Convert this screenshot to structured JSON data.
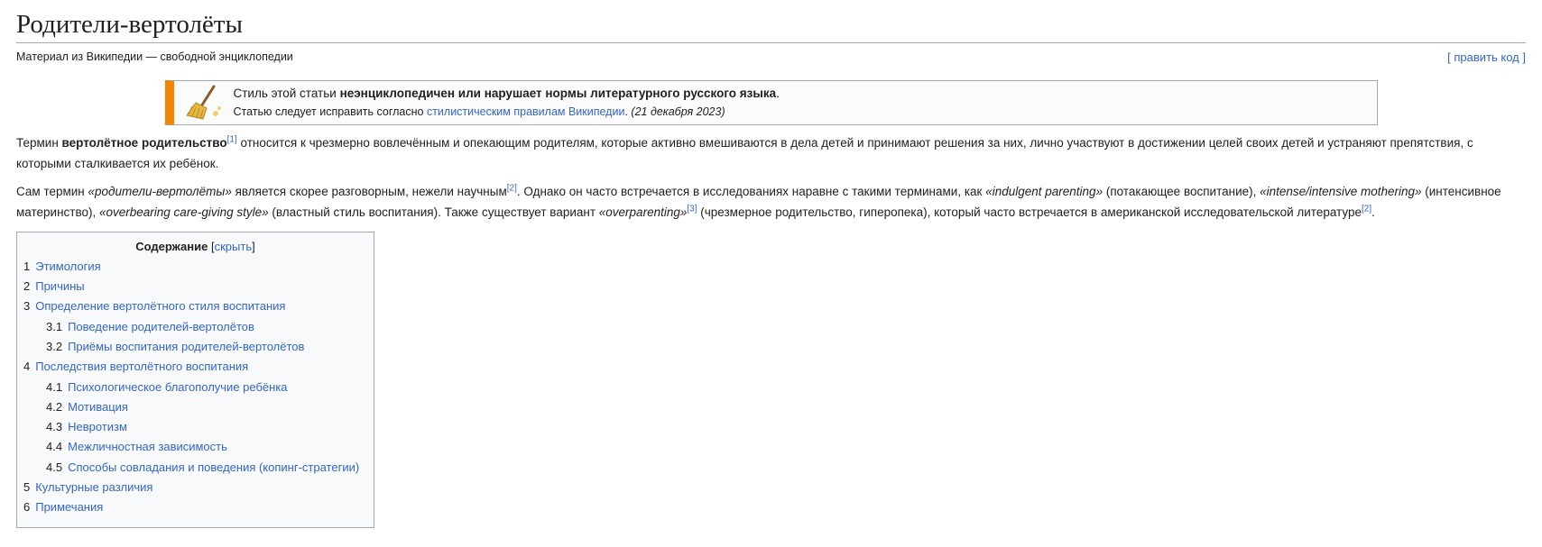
{
  "page": {
    "title": "Родители-вертолёты",
    "source": "Материал из Википедии — свободной энциклопедии",
    "edit_link": "[ править код ]"
  },
  "ambox": {
    "icon": "broom-icon",
    "accent_color": "#f28500",
    "line1_prefix": "Стиль этой статьи ",
    "line1_bold": "неэнциклопедичен или нарушает нормы литературного русского языка",
    "line1_suffix": ".",
    "line2_prefix": "Статью следует исправить согласно ",
    "line2_link": "стилистическим правилам Википедии",
    "line2_sep": ". ",
    "line2_date": "(21 декабря 2023)"
  },
  "para1": {
    "t1": "Термин ",
    "b1": "вертолётное родительство",
    "ref1": "[1]",
    "t2": " относится к чрезмерно вовлечённым и опекающим родителям, которые активно вмешиваются в дела детей и принимают решения за них, лично участвуют в достижении целей своих детей и устраняют препятствия, с которыми сталкивается их ребёнок."
  },
  "para2": {
    "t1": "Сам термин ",
    "i1": "«родители-вертолёты»",
    "t2": " является скорее разговорным, нежели научным",
    "ref1": "[2]",
    "t3": ". Однако он часто встречается в исследованиях наравне с такими терминами, как ",
    "i2": "«indulgent parenting»",
    "t4": " (потакающее воспитание), ",
    "i3": "«intense/intensive mothering»",
    "t5": " (интенсивное материнство), ",
    "i4": "«overbearing care-giving style»",
    "t6": " (властный стиль воспитания). Также существует вариант ",
    "i5": "«overparenting»",
    "ref2": "[3]",
    "t7": " (чрезмерное родительство, гиперопека), который часто встречается в американской исследовательской литературе",
    "ref3": "[2]",
    "t8": "."
  },
  "toc": {
    "title": "Содержание",
    "toggle_open": "[",
    "toggle": "скрыть",
    "toggle_close": "]",
    "items": [
      {
        "num": "1",
        "label": "Этимология",
        "level": 1
      },
      {
        "num": "2",
        "label": "Причины",
        "level": 1
      },
      {
        "num": "3",
        "label": "Определение вертолётного стиля воспитания",
        "level": 1
      },
      {
        "num": "3.1",
        "label": "Поведение родителей-вертолётов",
        "level": 2
      },
      {
        "num": "3.2",
        "label": "Приёмы воспитания родителей-вертолётов",
        "level": 2
      },
      {
        "num": "4",
        "label": "Последствия вертолётного воспитания",
        "level": 1
      },
      {
        "num": "4.1",
        "label": "Психологическое благополучие ребёнка",
        "level": 2
      },
      {
        "num": "4.2",
        "label": "Мотивация",
        "level": 2
      },
      {
        "num": "4.3",
        "label": "Невротизм",
        "level": 2
      },
      {
        "num": "4.4",
        "label": "Межличностная зависимость",
        "level": 2
      },
      {
        "num": "4.5",
        "label": "Способы совладания и поведения (копинг-стратегии)",
        "level": 2
      },
      {
        "num": "5",
        "label": "Культурные различия",
        "level": 1
      },
      {
        "num": "6",
        "label": "Примечания",
        "level": 1
      }
    ]
  }
}
